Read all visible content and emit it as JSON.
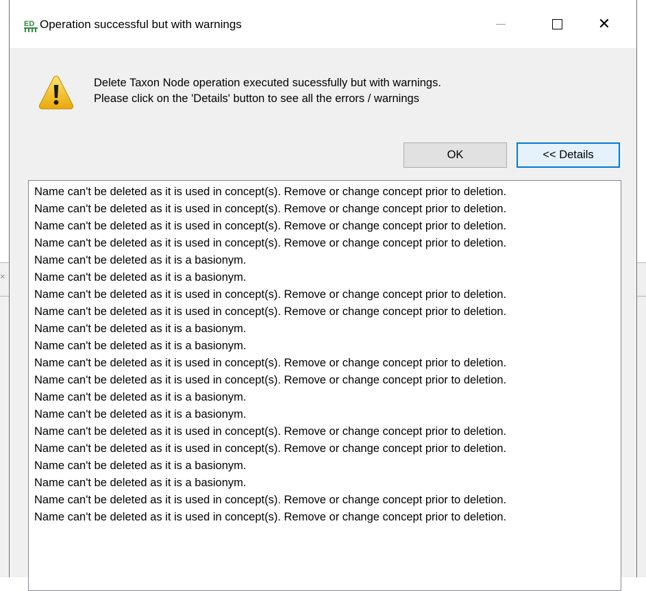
{
  "background": {
    "close_glyph": "×"
  },
  "dialog": {
    "title": "Operation successful but with warnings",
    "window_controls": {
      "minimize_icon": "minimize-icon",
      "maximize_icon": "maximize-icon",
      "close_icon": "close-icon",
      "close_glyph": "✕"
    },
    "icon": "warning-icon",
    "message_lines": [
      "Delete Taxon Node operation executed sucessfully but with warnings.",
      "Please click on the 'Details' button to see all the errors / warnings"
    ],
    "buttons": {
      "ok_label": "OK",
      "details_label": "<< Details"
    },
    "details": [
      "Name can't be deleted as it is used in concept(s). Remove or change concept prior to deletion.",
      "Name can't be deleted as it is used in concept(s). Remove or change concept prior to deletion.",
      "Name can't be deleted as it is used in concept(s). Remove or change concept prior to deletion.",
      "Name can't be deleted as it is used in concept(s). Remove or change concept prior to deletion.",
      "Name can't be deleted as it is a basionym.",
      "Name can't be deleted as it is a basionym.",
      "Name can't be deleted as it is used in concept(s). Remove or change concept prior to deletion.",
      "Name can't be deleted as it is used in concept(s). Remove or change concept prior to deletion.",
      "Name can't be deleted as it is a basionym.",
      "Name can't be deleted as it is a basionym.",
      "Name can't be deleted as it is used in concept(s). Remove or change concept prior to deletion.",
      "Name can't be deleted as it is used in concept(s). Remove or change concept prior to deletion.",
      "Name can't be deleted as it is a basionym.",
      "Name can't be deleted as it is a basionym.",
      "Name can't be deleted as it is used in concept(s). Remove or change concept prior to deletion.",
      "Name can't be deleted as it is used in concept(s). Remove or change concept prior to deletion.",
      "Name can't be deleted as it is a basionym.",
      "Name can't be deleted as it is a basionym.",
      "Name can't be deleted as it is used in concept(s). Remove or change concept prior to deletion.",
      "Name can't be deleted as it is used in concept(s). Remove or change concept prior to deletion."
    ]
  },
  "colors": {
    "accent": "#0078d7",
    "warning_yellow": "#f5c518",
    "dialog_bg": "#f0f0f0"
  }
}
